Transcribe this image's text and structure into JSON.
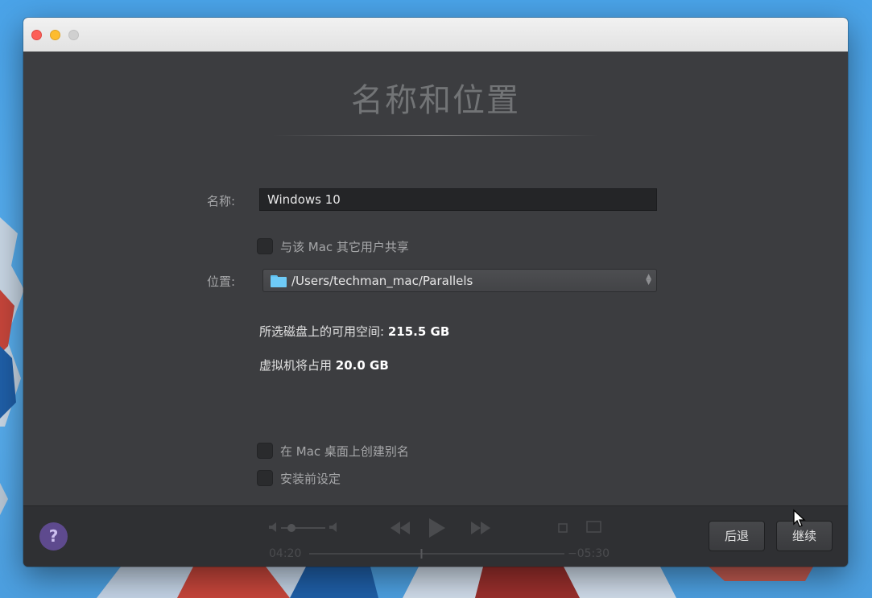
{
  "window": {
    "heading": "名称和位置"
  },
  "form": {
    "name_label": "名称:",
    "name_value": "Windows 10",
    "share_label": "与该 Mac 其它用户共享",
    "location_label": "位置:",
    "location_value": "/Users/techman_mac/Parallels",
    "free_space_label": "所选磁盘上的可用空间:",
    "free_space_value": "215.5 GB",
    "vm_use_label": "虚拟机将占用",
    "vm_use_value": "20.0 GB",
    "alias_label": "在 Mac 桌面上创建别名",
    "customize_label": "安装前设定"
  },
  "footer": {
    "help_label": "?",
    "back_label": "后退",
    "continue_label": "继续"
  },
  "player_overlay": {
    "elapsed": "04:20",
    "remaining": "−05:30",
    "progress": 0.44
  },
  "colors": {
    "desktop": "#4aa3e8",
    "window_bg": "#3c3d40",
    "help_button": "#5e4a8e",
    "folder_icon": "#6ecbf7"
  }
}
